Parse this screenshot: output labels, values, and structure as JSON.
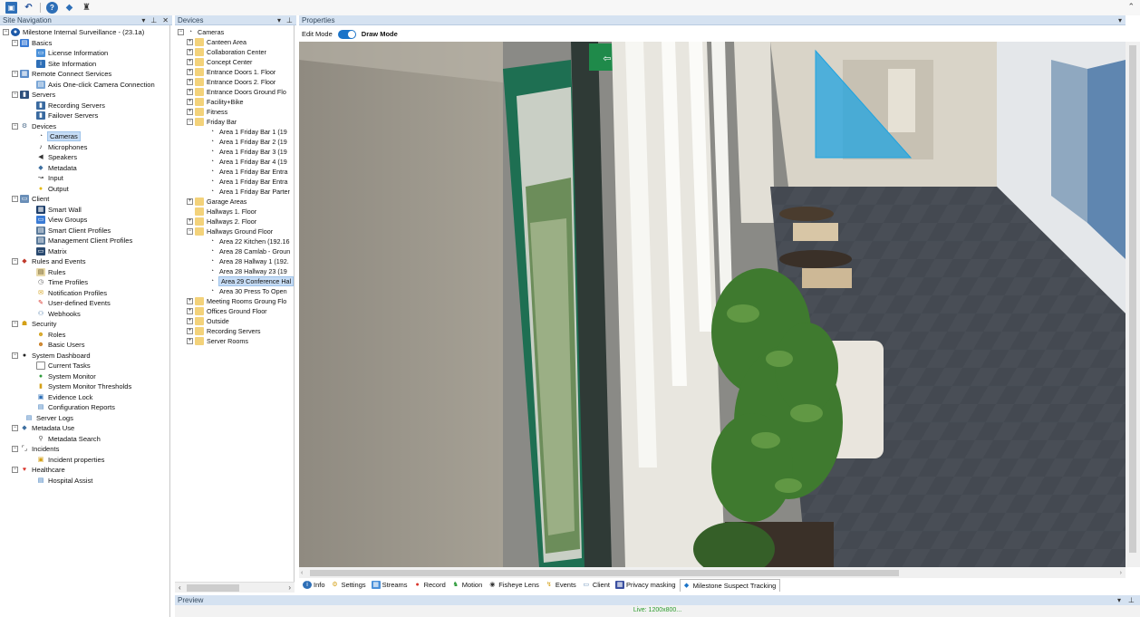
{
  "panes": {
    "site_navigation": "Site Navigation",
    "devices": "Devices",
    "properties": "Properties",
    "preview": "Preview"
  },
  "header_tools": {
    "dropdown": "▾",
    "pin": "⊥",
    "close": "✕"
  },
  "site_nav": {
    "root": "Milestone Internal Surveillance - (23.1a)",
    "basics": "Basics",
    "license_information": "License Information",
    "site_information": "Site Information",
    "remote_connect_services": "Remote Connect Services",
    "axis_one_click": "Axis One-click Camera Connection",
    "servers": "Servers",
    "recording_servers": "Recording Servers",
    "failover_servers": "Failover Servers",
    "devices": "Devices",
    "cameras": "Cameras",
    "microphones": "Microphones",
    "speakers": "Speakers",
    "metadata": "Metadata",
    "input": "Input",
    "output": "Output",
    "client": "Client",
    "smart_wall": "Smart Wall",
    "view_groups": "View Groups",
    "smart_client_profiles": "Smart Client Profiles",
    "management_client_profiles": "Management Client Profiles",
    "matrix": "Matrix",
    "rules_and_events": "Rules and Events",
    "rules": "Rules",
    "time_profiles": "Time Profiles",
    "notification_profiles": "Notification Profiles",
    "user_defined_events": "User-defined Events",
    "webhooks": "Webhooks",
    "security": "Security",
    "roles": "Roles",
    "basic_users": "Basic Users",
    "system_dashboard": "System Dashboard",
    "current_tasks": "Current Tasks",
    "system_monitor": "System Monitor",
    "system_monitor_thresholds": "System Monitor Thresholds",
    "evidence_lock": "Evidence Lock",
    "configuration_reports": "Configuration Reports",
    "server_logs": "Server Logs",
    "metadata_use": "Metadata Use",
    "metadata_search": "Metadata Search",
    "incidents": "Incidents",
    "incident_properties": "Incident properties",
    "healthcare": "Healthcare",
    "hospital_assist": "Hospital Assist"
  },
  "device_tree": {
    "cameras": "Cameras",
    "canteen_area": "Canteen Area",
    "collaboration_center": "Collaboration Center",
    "concept_center": "Concept Center",
    "entrance_doors_1": "Entrance Doors 1. Floor",
    "entrance_doors_2": "Entrance Doors 2. Floor",
    "entrance_doors_ground": "Entrance Doors Ground Flo",
    "facility_bike": "Facility+Bike",
    "fitness": "Fitness",
    "friday_bar": "Friday Bar",
    "fb_area1_bar1": "Area 1 Friday Bar 1 (19",
    "fb_area1_bar2": "Area 1 Friday Bar 2 (19",
    "fb_area1_bar3": "Area 1 Friday Bar 3 (19",
    "fb_area1_bar4": "Area 1 Friday Bar 4 (19",
    "fb_area1_entra_a": "Area 1 Friday Bar Entra",
    "fb_area1_entra_b": "Area 1 Friday Bar Entra",
    "fb_area1_parter": "Area 1 Friday Bar Parter",
    "garage_areas": "Garage Areas",
    "hallways_1": "Hallways 1. Floor",
    "hallways_2": "Hallways 2. Floor",
    "hallways_ground": "Hallways Ground Floor",
    "hg_area22": "Area 22 Kitchen (192.16",
    "hg_area28_camlab": "Area 28 Camlab - Groun",
    "hg_area28_hallway1": "Area 28 Hallway 1 (192.",
    "hg_area28_hallway23": "Area 28 Hallway 23 (19",
    "hg_area29": "Area 29 Conference Hal",
    "hg_area30": "Area 30 Press To Open",
    "meeting_rooms": "Meeting Rooms Groung Flo",
    "offices_ground": "Offices Ground Floor",
    "outside": "Outside",
    "recording_servers": "Recording Servers",
    "server_rooms": "Server Rooms"
  },
  "mode": {
    "edit": "Edit Mode",
    "draw": "Draw Mode"
  },
  "tabs": {
    "info": "Info",
    "settings": "Settings",
    "streams": "Streams",
    "record": "Record",
    "motion": "Motion",
    "fisheye": "Fisheye Lens",
    "events": "Events",
    "client": "Client",
    "privacy": "Privacy masking",
    "suspect": "Milestone Suspect Tracking"
  },
  "preview": {
    "live_label": "Live: 1200x800..."
  },
  "colors": {
    "pane_header": "#d5e2f1",
    "accent": "#1a73c8",
    "selection": "#c6dcf5",
    "polygon": "#1fa3e0"
  }
}
